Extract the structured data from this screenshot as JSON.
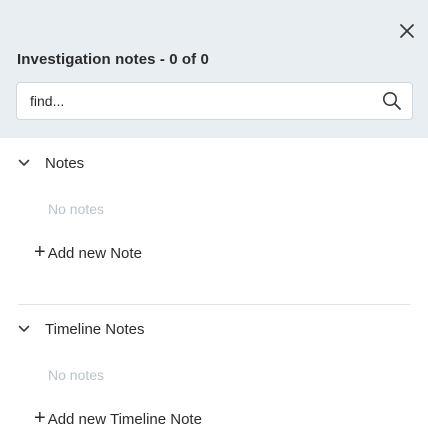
{
  "header": {
    "title": "Investigation notes - 0 of 0",
    "close_icon": "close-icon"
  },
  "search": {
    "placeholder": "find...",
    "value": "",
    "icon": "search-icon"
  },
  "notes_section": {
    "label": "Notes",
    "empty_text": "No notes",
    "add_label": "Add new Note",
    "add_symbol": "+"
  },
  "timeline_section": {
    "label": "Timeline Notes",
    "empty_text": "No notes",
    "add_label": "Add new Timeline Note",
    "add_symbol": "+"
  },
  "colors": {
    "header_bg": "#e9eef3",
    "text": "#2b2b2b",
    "muted": "#b9c3cc",
    "border": "#cfd6dd"
  }
}
